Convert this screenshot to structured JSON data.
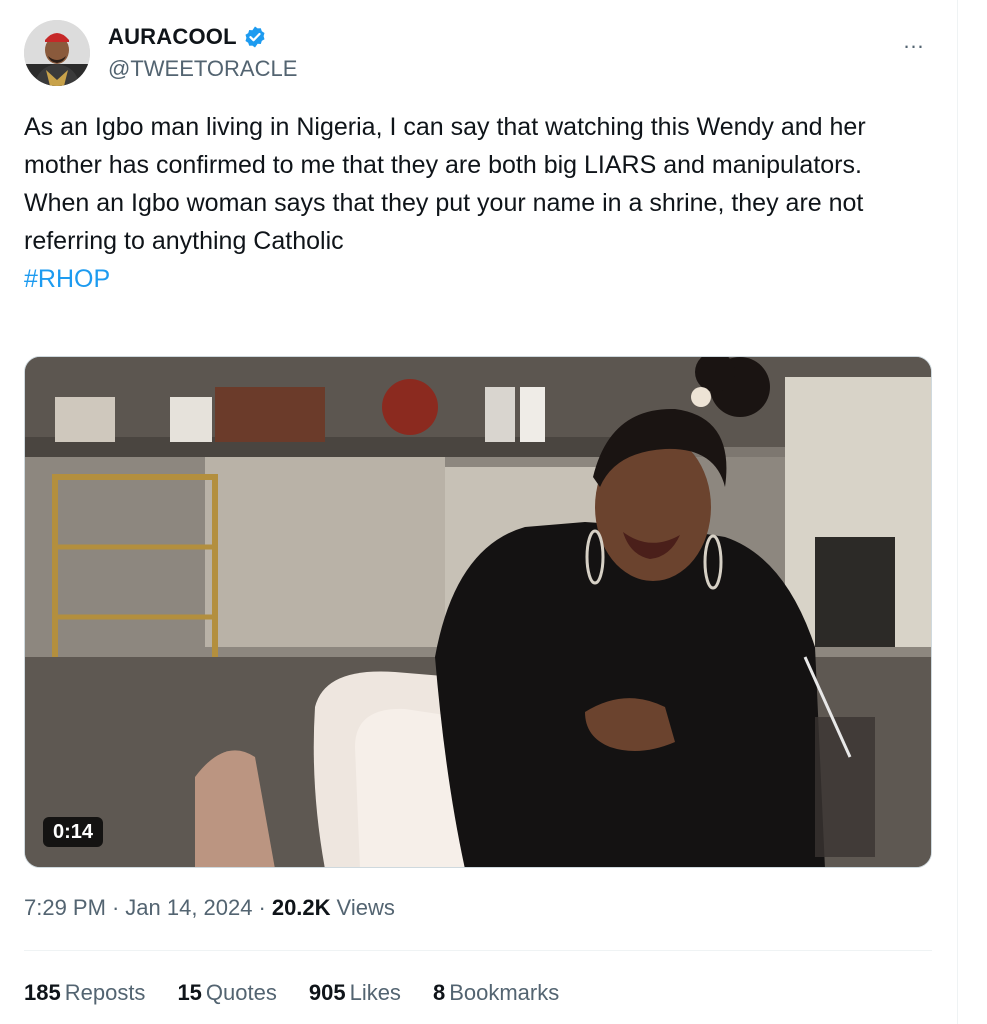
{
  "author": {
    "display_name": "AURACOOL",
    "handle": "@TWEETORACLE",
    "verified": true
  },
  "more_icon": "…",
  "tweet": {
    "text": "As an Igbo man living in Nigeria, I can say that watching this Wendy and her mother has confirmed to me that they are both big LIARS and manipulators.\nWhen an Igbo woman says that they put your name in a shrine, they are not referring to anything Catholic",
    "hashtag": "#RHOP"
  },
  "video": {
    "duration": "0:14"
  },
  "meta": {
    "time": "7:29 PM",
    "separator": "·",
    "date": "Jan 14, 2024",
    "views_count": "20.2K",
    "views_label": "Views"
  },
  "stats": [
    {
      "count": "185",
      "label": "Reposts"
    },
    {
      "count": "15",
      "label": "Quotes"
    },
    {
      "count": "905",
      "label": "Likes"
    },
    {
      "count": "8",
      "label": "Bookmarks"
    }
  ],
  "colors": {
    "accent": "#1d9bf0",
    "secondary_text": "#536471",
    "primary_text": "#0f1419"
  }
}
